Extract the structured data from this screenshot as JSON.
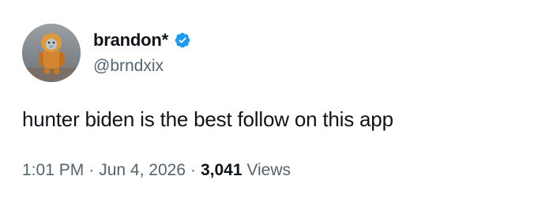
{
  "author": {
    "display_name": "brandon*",
    "handle": "@brndxix",
    "verified": true,
    "verified_color": "#1d9bf0",
    "avatar": "monkey-avatar"
  },
  "post": {
    "text": "hunter biden is the best follow on this app"
  },
  "meta": {
    "time": "1:01 PM",
    "separator": "·",
    "date": "Jun 4, 2026",
    "views_count": "3,041",
    "views_label": "Views"
  }
}
